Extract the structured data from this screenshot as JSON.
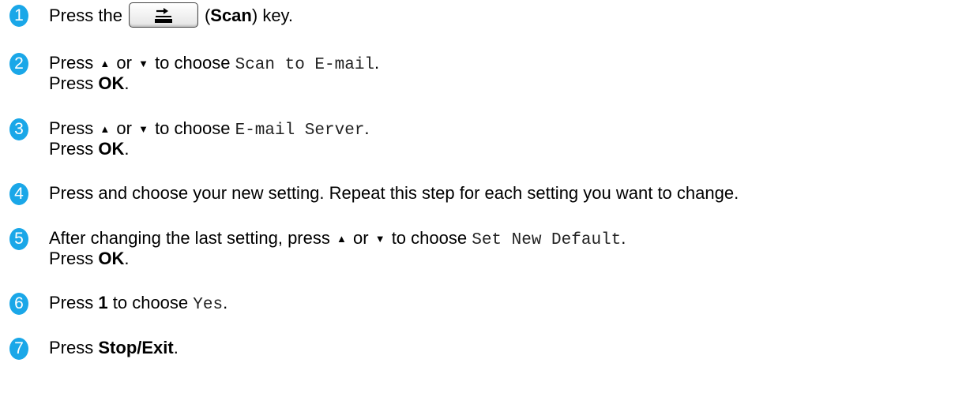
{
  "steps": [
    {
      "num": "1",
      "pre": "Press the",
      "key_name": "Scan",
      "post": "key."
    },
    {
      "num": "2",
      "press": "Press",
      "or": "or",
      "to_choose": "to choose",
      "code": "Scan to E-mail",
      "punct": ".",
      "ok_press": "Press",
      "ok": "OK",
      "ok_punct": "."
    },
    {
      "num": "3",
      "press": "Press",
      "or": "or",
      "to_choose": "to choose",
      "code": "E-mail Server",
      "punct": ".",
      "ok_press": "Press",
      "ok": "OK",
      "ok_punct": "."
    },
    {
      "num": "4",
      "text": "Press and choose your new setting. Repeat this step for each setting you want to change."
    },
    {
      "num": "5",
      "pre": "After changing the last setting, press",
      "or": "or",
      "to_choose": "to choose",
      "code": "Set New Default",
      "punct": ".",
      "ok_press": "Press",
      "ok": "OK",
      "ok_punct": "."
    },
    {
      "num": "6",
      "press": "Press",
      "key": "1",
      "to_choose": "to choose",
      "code": "Yes",
      "punct": "."
    },
    {
      "num": "7",
      "press": "Press",
      "key": "Stop/Exit",
      "punct": "."
    }
  ],
  "icons": {
    "up": "up-triangle-icon",
    "down": "down-triangle-icon",
    "scan": "scan-key-icon"
  },
  "colors": {
    "badge": "#1aa7e8",
    "text": "#000000"
  }
}
